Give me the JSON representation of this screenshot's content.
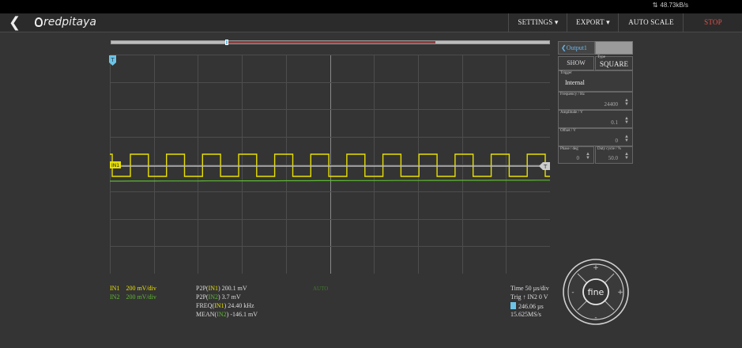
{
  "statusbar": {
    "net_icon": "signal-icon",
    "net_rate": "48.73kB/s"
  },
  "navbar": {
    "back_icon": "chevron-left-icon",
    "logo_text": "redpitaya",
    "buttons": [
      {
        "id": "settings",
        "label": "SETTINGS ▾"
      },
      {
        "id": "export",
        "label": "EXPORT ▾"
      },
      {
        "id": "autoscale",
        "label": "AUTO SCALE"
      },
      {
        "id": "stop",
        "label": "STOP"
      }
    ]
  },
  "colors": {
    "in1": "#e8e000",
    "in2": "#5fb830",
    "accent": "#6cc4e6",
    "stop": "#e0524a",
    "background": "#343434"
  },
  "graph": {
    "trigger_marker": "T",
    "in1_marker": "IN1",
    "trig_level_marker": "T",
    "signal_in1": {
      "type": "square",
      "periods_visible": 12.2,
      "duty": 0.5
    },
    "signal_in2": {
      "type": "flat"
    }
  },
  "output_panel": {
    "header": "Output1",
    "show_label": "SHOW",
    "type_label": "Type",
    "type_value": "SQUARE",
    "trigger_label": "Trigger",
    "trigger_value": "Internal",
    "frequency_label": "Frequency / Hz",
    "frequency_value": "24400",
    "amplitude_label": "Amplitude / V",
    "amplitude_value": "0.1",
    "offset_label": "Offset / V",
    "offset_value": "0",
    "phase_label": "Phase / deg",
    "phase_value": "0",
    "duty_label": "Duty cycle / %",
    "duty_value": "50.0"
  },
  "channels": {
    "in1_name": "IN1",
    "in1_scale": "200 mV/div",
    "in2_name": "IN2",
    "in2_scale": "200 mV/div"
  },
  "measurements": [
    {
      "pre": "P2P(",
      "ch": "IN1",
      "post": ") 200.1  mV",
      "cls": "y"
    },
    {
      "pre": "P2P(",
      "ch": "IN2",
      "post": ") 3.7  mV",
      "cls": "g"
    },
    {
      "pre": "FREQ(",
      "ch": "IN1",
      "post": ") 24.40  kHz",
      "cls": "y"
    },
    {
      "pre": "MEAN(",
      "ch": "IN2",
      "post": ") -146.1  mV",
      "cls": "g"
    }
  ],
  "acq_mode": "AUTO",
  "timebase": {
    "time": "Time 50 µs/div",
    "trig": "Trig ↑ IN2 0 V",
    "cursor": "246.06 µs",
    "rate": "15.625MS/s"
  },
  "jog": {
    "center": "fine",
    "up": "+",
    "down": "-",
    "left": "-",
    "right": "+"
  }
}
